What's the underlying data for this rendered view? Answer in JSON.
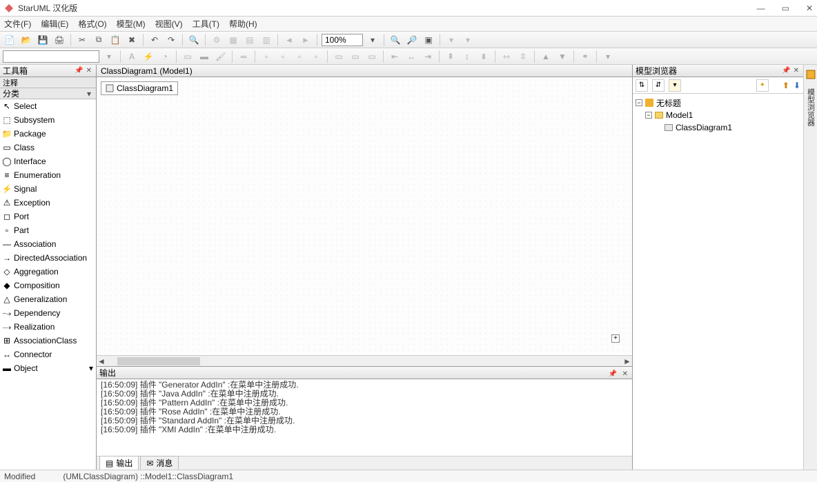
{
  "app": {
    "title": "StarUML 汉化版"
  },
  "menu": {
    "file": "文件(F)",
    "edit": "编辑(E)",
    "format": "格式(O)",
    "model": "模型(M)",
    "view": "视图(V)",
    "tool": "工具(T)",
    "help": "帮助(H)"
  },
  "toolbar": {
    "zoom": "100%"
  },
  "toolbox": {
    "title": "工具箱",
    "section_annotation": "注释",
    "section_class": "分类",
    "items": [
      "Select",
      "Subsystem",
      "Package",
      "Class",
      "Interface",
      "Enumeration",
      "Signal",
      "Exception",
      "Port",
      "Part",
      "Association",
      "DirectedAssociation",
      "Aggregation",
      "Composition",
      "Generalization",
      "Dependency",
      "Realization",
      "AssociationClass",
      "Connector",
      "Object"
    ]
  },
  "document": {
    "tab_label": "ClassDiagram1 (Model1)",
    "diagram_tab": "ClassDiagram1"
  },
  "explorer": {
    "title": "模型浏览器",
    "root": "无标题",
    "model": "Model1",
    "diagram": "ClassDiagram1",
    "sidebar_label": "模型浏览器"
  },
  "output": {
    "title": "输出",
    "lines": [
      "[16:50:09]  插件  \"Generator AddIn\" :在菜单中注册成功.",
      "[16:50:09]  插件  \"Java AddIn\" :在菜单中注册成功.",
      "[16:50:09]  插件  \"Pattern AddIn\" :在菜单中注册成功.",
      "[16:50:09]  插件  \"Rose AddIn\" :在菜单中注册成功.",
      "[16:50:09]  插件  \"Standard AddIn\" :在菜单中注册成功.",
      "[16:50:09]  插件  \"XMI AddIn\" :在菜单中注册成功."
    ]
  },
  "bottom_tabs": {
    "output": "输出",
    "message": "消息"
  },
  "status": {
    "modified": "Modified",
    "path": "(UMLClassDiagram) ::Model1::ClassDiagram1"
  }
}
